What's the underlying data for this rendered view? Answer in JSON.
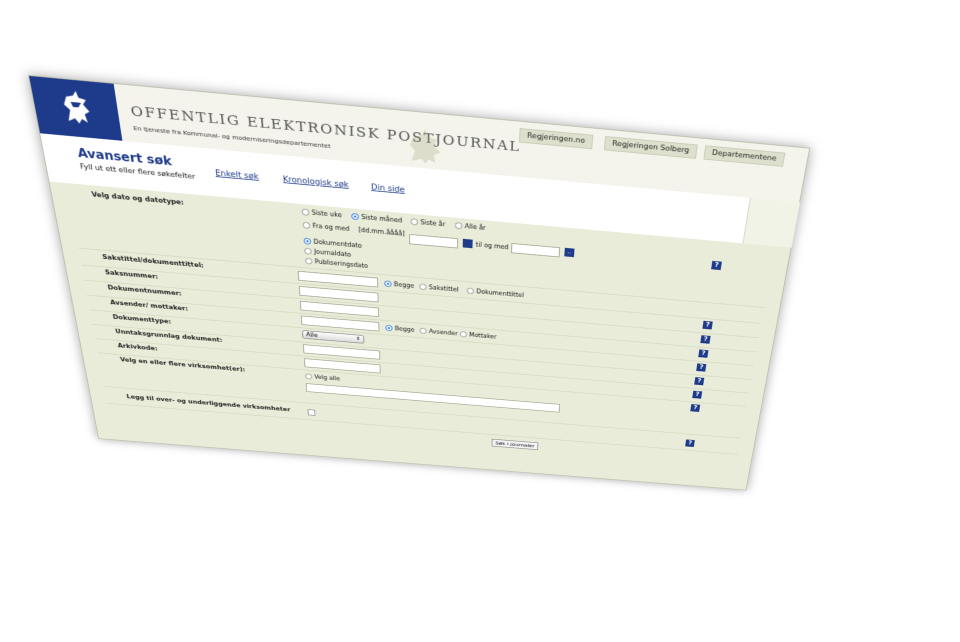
{
  "header": {
    "site_title": "OFFENTLIG ELEKTRONISK POSTJOURNAL",
    "site_subtitle": "En tjeneste fra Kommunal- og moderniseringsdepartementet",
    "top_links": [
      "Regjeringen.no",
      "Regjeringen Solberg",
      "Departementene"
    ]
  },
  "nav": {
    "page_title": "Avansert søk",
    "page_subtitle": "Fyll ut ett eller flere søkefelter",
    "links": [
      "Enkelt søk",
      "Kronologisk søk",
      "Din side"
    ]
  },
  "form": {
    "date": {
      "label": "Velg dato og datotype:",
      "period_options": [
        "Siste uke",
        "Siste måned",
        "Siste år",
        "Alle år"
      ],
      "period_selected": "Siste måned",
      "from_label": "Fra og med",
      "format_hint": "[dd.mm.åååå]",
      "to_label": "til og med",
      "from_value": "",
      "to_value": "",
      "type_options": [
        "Dokumentdato",
        "Journaldato",
        "Publiseringsdato"
      ],
      "type_selected": "Dokumentdato"
    },
    "case_title": {
      "label": "Sakstittel/dokumenttittel:",
      "options": [
        "Begge",
        "Sakstittel",
        "Dokumenttittel"
      ],
      "selected": "Begge"
    },
    "case_number_label": "Saksnummer:",
    "document_number_label": "Dokumentnummer:",
    "sender": {
      "label": "Avsender/ mottaker:",
      "options": [
        "Begge",
        "Avsender",
        "Mottaker"
      ],
      "selected": "Begge"
    },
    "document_type": {
      "label": "Dokumenttype:",
      "value": "Alle"
    },
    "exemption_label": "Unntaksgrunnlag dokument:",
    "archive_code_label": "Arkivkode:",
    "agencies": {
      "label": "Velg en eller flere virksomhet(er):",
      "select_all": "Velg alle"
    },
    "include_related_label": "Legg til over- og underliggende virksomheter",
    "help_glyph": "?",
    "calendar_glyph": "..",
    "submit_label": "Søk i journaler"
  }
}
